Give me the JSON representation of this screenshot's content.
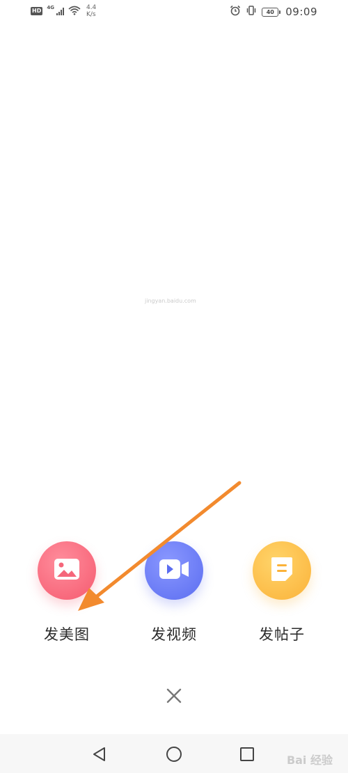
{
  "status_bar": {
    "hd": "HD",
    "net_type": "4G",
    "speed_value": "4.4",
    "speed_unit": "K/s",
    "battery": "40",
    "time": "09:09"
  },
  "actions": [
    {
      "label": "发美图",
      "icon": "image-icon",
      "color": "#f55a6f"
    },
    {
      "label": "发视频",
      "icon": "video-icon",
      "color": "#5b6df0"
    },
    {
      "label": "发帖子",
      "icon": "post-icon",
      "color": "#fbb239"
    }
  ],
  "close_icon": "close-icon",
  "annotation": {
    "arrow_color": "#f28a2e"
  },
  "watermark": {
    "brand": "Bai 经验",
    "url": "jingyan.baidu.com"
  },
  "nav_bar": {
    "back_icon": "back-triangle-icon",
    "home_icon": "home-circle-icon",
    "recent_icon": "recent-square-icon"
  }
}
